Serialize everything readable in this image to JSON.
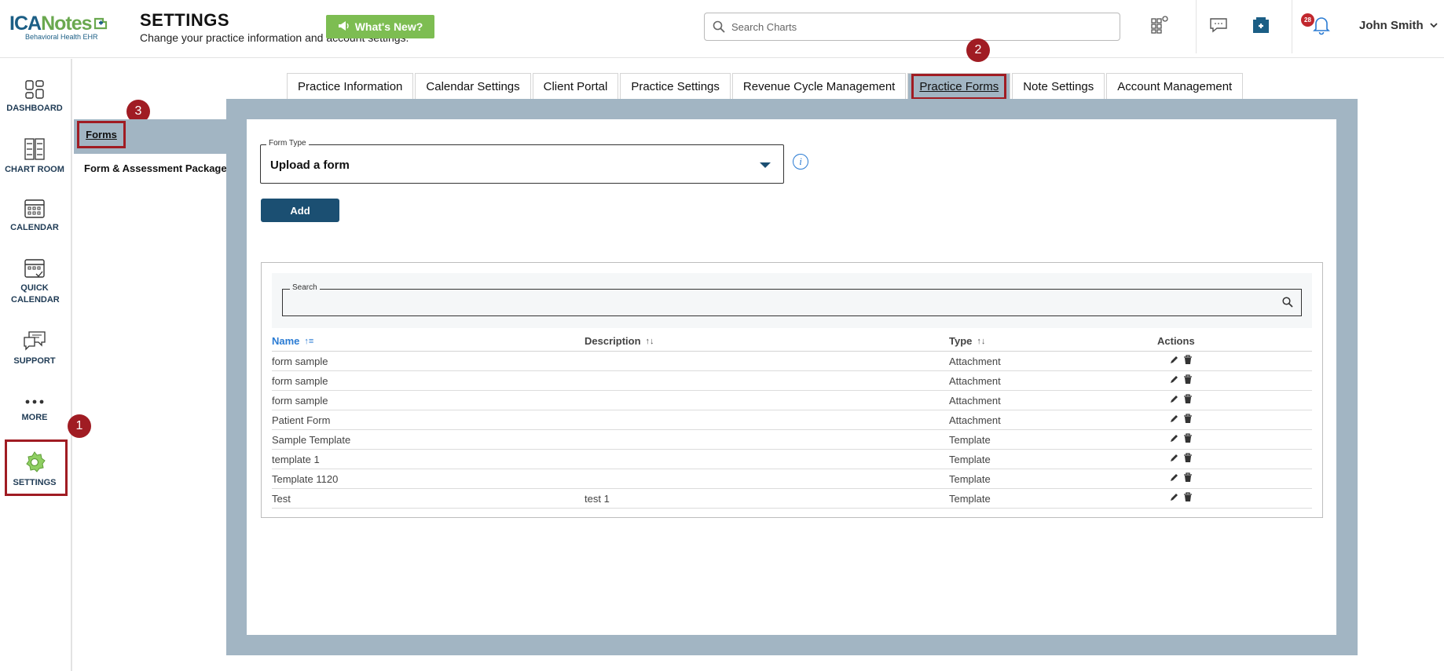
{
  "header": {
    "logo_primary": "ICA",
    "logo_secondary": "Notes",
    "logo_tagline": "Behavioral Health EHR",
    "title": "SETTINGS",
    "subtitle": "Change your practice information and account settings.",
    "whats_new_label": "What's New?",
    "search_placeholder": "Search Charts",
    "notification_count": "28",
    "user_name": "John Smith"
  },
  "left_nav": [
    {
      "label": "DASHBOARD"
    },
    {
      "label": "CHART ROOM"
    },
    {
      "label": "CALENDAR"
    },
    {
      "label": "QUICK CALENDAR"
    },
    {
      "label": "SUPPORT"
    },
    {
      "label": "MORE"
    },
    {
      "label": "SETTINGS"
    }
  ],
  "markers": [
    "1",
    "2",
    "3"
  ],
  "tabs": [
    {
      "label": "Practice Information"
    },
    {
      "label": "Calendar Settings"
    },
    {
      "label": "Client Portal"
    },
    {
      "label": "Practice Settings"
    },
    {
      "label": "Revenue Cycle Management"
    },
    {
      "label": "Practice Forms"
    },
    {
      "label": "Note Settings"
    },
    {
      "label": "Account Management"
    }
  ],
  "active_tab": "Practice Forms",
  "sub_nav": {
    "forms": "Forms",
    "package": "Form & Assessment Package"
  },
  "form": {
    "form_type_label": "Form Type",
    "form_type_value": "Upload a form",
    "add_label": "Add"
  },
  "table": {
    "search_label": "Search",
    "columns": [
      "Name",
      "Description",
      "Type",
      "Actions"
    ],
    "rows": [
      {
        "name": "form sample",
        "description": "",
        "type": "Attachment"
      },
      {
        "name": "form sample",
        "description": "",
        "type": "Attachment"
      },
      {
        "name": "form sample",
        "description": "",
        "type": "Attachment"
      },
      {
        "name": "Patient Form",
        "description": "",
        "type": "Attachment"
      },
      {
        "name": "Sample Template",
        "description": "",
        "type": "Template"
      },
      {
        "name": "template 1",
        "description": "",
        "type": "Template"
      },
      {
        "name": "Template 1120",
        "description": "",
        "type": "Template"
      },
      {
        "name": "Test",
        "description": "test 1",
        "type": "Template"
      }
    ]
  },
  "colors": {
    "brand_blue": "#1b5e85",
    "brand_green": "#6aa84f",
    "panel": "#a2b5c3",
    "primary_button": "#1b4f72",
    "highlight": "#a01c23",
    "link_blue": "#2a7bd3"
  }
}
